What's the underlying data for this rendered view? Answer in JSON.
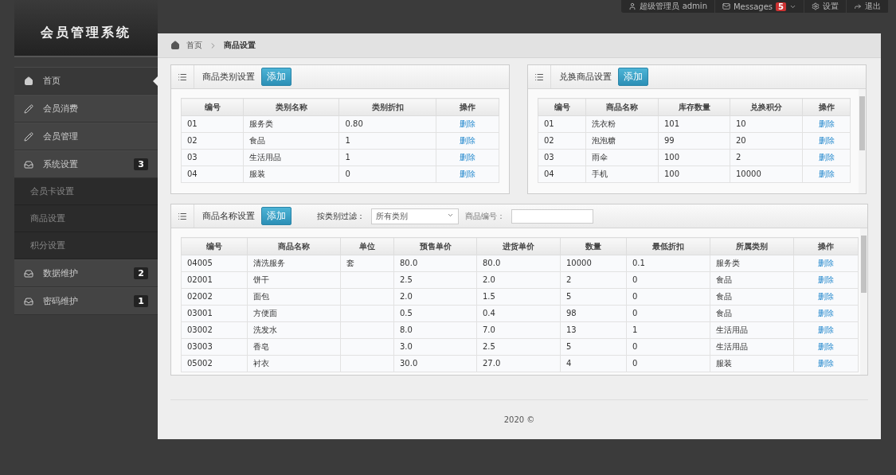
{
  "top_nav": {
    "user": "超级管理员 admin",
    "messages_label": "Messages",
    "messages_count": "5",
    "settings": "设置",
    "logout": "退出"
  },
  "app_title": "会员管理系统",
  "sidebar": {
    "items": [
      {
        "label": "首页",
        "kind": "home",
        "selected": true
      },
      {
        "label": "会员消费",
        "kind": "pencil",
        "selected": false
      },
      {
        "label": "会员管理",
        "kind": "pencil",
        "selected": false
      },
      {
        "label": "系统设置",
        "kind": "tray",
        "selected": false,
        "badge": "3",
        "children": [
          {
            "label": "会员卡设置",
            "selected": false
          },
          {
            "label": "商品设置",
            "selected": false
          },
          {
            "label": "积分设置",
            "selected": false
          }
        ]
      },
      {
        "label": "数据维护",
        "kind": "tray",
        "selected": false,
        "badge": "2"
      },
      {
        "label": "密码维护",
        "kind": "tray",
        "selected": false,
        "badge": "1"
      }
    ]
  },
  "breadcrumb": [
    "首页",
    "商品设置"
  ],
  "category_panel": {
    "title": "商品类别设置",
    "add_button": "添加",
    "columns": [
      "编号",
      "类别名称",
      "类别折扣",
      "操作"
    ],
    "rows": [
      [
        "01",
        "服务类",
        "0.80",
        "删除"
      ],
      [
        "02",
        "食品",
        "1",
        "删除"
      ],
      [
        "03",
        "生活用品",
        "1",
        "删除"
      ],
      [
        "04",
        "服装",
        "0",
        "删除"
      ]
    ]
  },
  "exchange_panel": {
    "title": "兑换商品设置",
    "add_button": "添加",
    "columns": [
      "编号",
      "商品名称",
      "库存数量",
      "兑换积分",
      "操作"
    ],
    "rows": [
      [
        "01",
        "洗衣粉",
        "101",
        "10",
        "删除"
      ],
      [
        "02",
        "泡泡糖",
        "99",
        "20",
        "删除"
      ],
      [
        "03",
        "雨伞",
        "100",
        "2",
        "删除"
      ],
      [
        "04",
        "手机",
        "100",
        "10000",
        "删除"
      ]
    ]
  },
  "product_panel": {
    "title": "商品名称设置",
    "add_button": "添加",
    "filter_label": "按类别过滤：",
    "filter_value": "所有类别",
    "code_label": "商品编号：",
    "columns": [
      "编号",
      "商品名称",
      "单位",
      "预售单价",
      "进货单价",
      "数量",
      "最低折扣",
      "所属类别",
      "操作"
    ],
    "rows": [
      [
        "04005",
        "清洗服务",
        "套",
        "80.0",
        "80.0",
        "10000",
        "0.1",
        "服务类",
        "删除"
      ],
      [
        "02001",
        "饼干",
        "",
        "2.5",
        "2.0",
        "2",
        "0",
        "食品",
        "删除"
      ],
      [
        "02002",
        "面包",
        "",
        "2.0",
        "1.5",
        "5",
        "0",
        "食品",
        "删除"
      ],
      [
        "03001",
        "方便面",
        "",
        "0.5",
        "0.4",
        "98",
        "0",
        "食品",
        "删除"
      ],
      [
        "03002",
        "洗发水",
        "",
        "8.0",
        "7.0",
        "13",
        "1",
        "生活用品",
        "删除"
      ],
      [
        "03003",
        "香皂",
        "",
        "3.0",
        "2.5",
        "5",
        "0",
        "生活用品",
        "删除"
      ],
      [
        "05002",
        "衬衣",
        "",
        "30.0",
        "27.0",
        "4",
        "0",
        "服装",
        "删除"
      ]
    ]
  },
  "footer": "2020 ©"
}
